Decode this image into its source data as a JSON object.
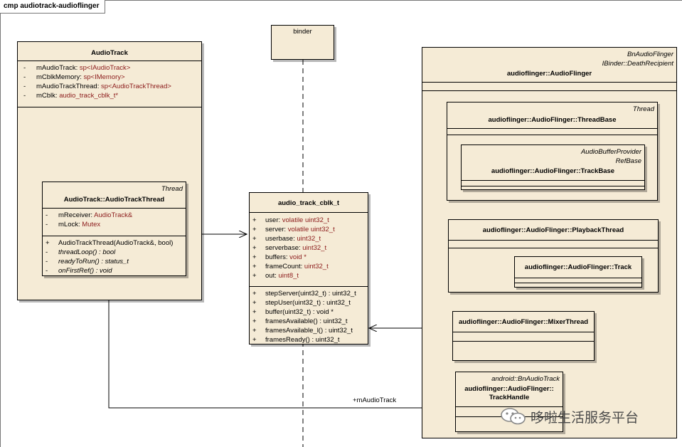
{
  "frame": {
    "title": "cmp audiotrack-audioflinger"
  },
  "binder": {
    "name": "binder"
  },
  "audio_track": {
    "name": "AudioTrack",
    "attributes": [
      {
        "vis": "-",
        "name": "mAudioTrack:",
        "type": "sp<IAudioTrack>"
      },
      {
        "vis": "-",
        "name": "mCblkMemory:",
        "type": "sp<IMemory>"
      },
      {
        "vis": "-",
        "name": "mAudioTrackThread:",
        "type": "sp<AudioTrackThread>"
      },
      {
        "vis": "-",
        "name": "mCblk:",
        "type": "audio_track_cblk_t*"
      }
    ]
  },
  "audio_track_thread": {
    "stereotype": "Thread",
    "name": "AudioTrack::AudioTrackThread",
    "attributes": [
      {
        "vis": "-",
        "name": "mReceiver:",
        "type": "AudioTrack&"
      },
      {
        "vis": "-",
        "name": "mLock:",
        "type": "Mutex"
      }
    ],
    "operations": [
      {
        "vis": "+",
        "text": "AudioTrackThread(AudioTrack&, bool)",
        "italic": false
      },
      {
        "vis": "-",
        "text": "threadLoop() : bool",
        "italic": true
      },
      {
        "vis": "-",
        "text": "readyToRun() : status_t",
        "italic": true
      },
      {
        "vis": "-",
        "text": "onFirstRef() : void",
        "italic": true
      }
    ]
  },
  "cblk": {
    "name": "audio_track_cblk_t",
    "attributes": [
      {
        "vis": "+",
        "name": "user:",
        "type": "volatile uint32_t"
      },
      {
        "vis": "+",
        "name": "server:",
        "type": "volatile uint32_t"
      },
      {
        "vis": "+",
        "name": "userbase:",
        "type": "uint32_t"
      },
      {
        "vis": "+",
        "name": "serverbase:",
        "type": "uint32_t"
      },
      {
        "vis": "+",
        "name": "buffers:",
        "type": "void *"
      },
      {
        "vis": "+",
        "name": "frameCount:",
        "type": "uint32_t"
      },
      {
        "vis": "+",
        "name": "out:",
        "type": "uint8_t"
      }
    ],
    "operations": [
      {
        "vis": "+",
        "text": "stepServer(uint32_t) : uint32_t"
      },
      {
        "vis": "+",
        "text": "stepUser(uint32_t) : uint32_t"
      },
      {
        "vis": "+",
        "text": "buffer(uint32_t) : void *"
      },
      {
        "vis": "+",
        "text": "framesAvailable() : uint32_t"
      },
      {
        "vis": "+",
        "text": "framesAvailable_l() : uint32_t"
      },
      {
        "vis": "+",
        "text": "framesReady() : uint32_t"
      }
    ]
  },
  "audio_flinger": {
    "stereotypes": [
      "BnAudioFlinger",
      "IBinder::DeathRecipient"
    ],
    "name": "audioflinger::AudioFlinger"
  },
  "thread_base": {
    "stereotype": "Thread",
    "name": "audioflinger::AudioFlinger::ThreadBase"
  },
  "track_base": {
    "stereotypes": [
      "AudioBufferProvider",
      "RefBase"
    ],
    "name": "audioflinger::AudioFlinger::TrackBase"
  },
  "playback_thread": {
    "name": "audioflinger::AudioFlinger::PlaybackThread"
  },
  "track": {
    "name": "audioflinger::AudioFlinger::Track"
  },
  "mixer_thread": {
    "name": "audioflinger::AudioFlinger::MixerThread"
  },
  "track_handle": {
    "stereotype": "android::BnAudioTrack",
    "name_line1": "audioflinger::AudioFlinger::",
    "name_line2": "TrackHandle"
  },
  "association": {
    "label": "+mAudioTrack"
  },
  "watermark": {
    "text": "哆啦生活服务平台"
  }
}
